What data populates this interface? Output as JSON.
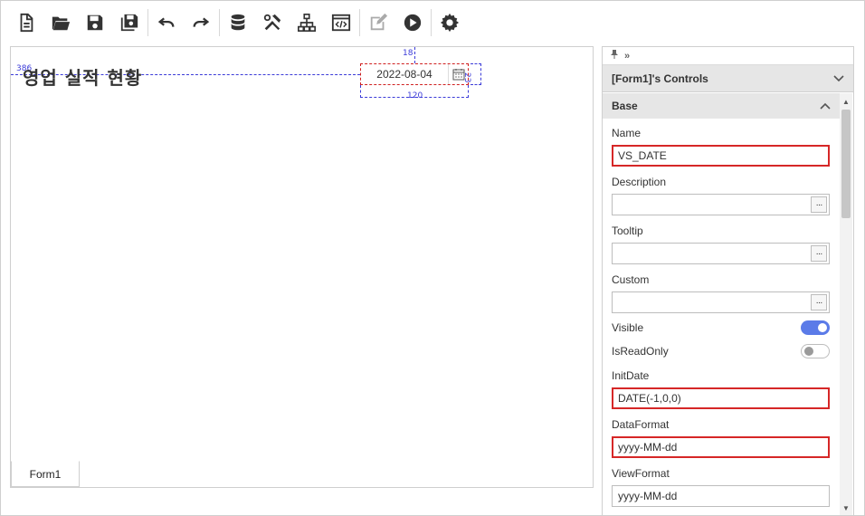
{
  "toolbar": {
    "items": [
      "new-file-icon",
      "open-folder-icon",
      "save-icon",
      "save-all-icon",
      "undo-icon",
      "redo-icon",
      "database-icon",
      "tools-icon",
      "hierarchy-icon",
      "code-icon",
      "edit-icon",
      "run-icon",
      "settings-icon"
    ]
  },
  "canvas": {
    "title_text": "영업 실적 현황",
    "date_value": "2022-08-04",
    "measure_left": "386",
    "measure_top": "18",
    "measure_width": "120",
    "measure_height": "23",
    "tab_label": "Form1"
  },
  "panel": {
    "header": "[Form1]'s Controls",
    "section": "Base",
    "name_label": "Name",
    "name_value": "VS_DATE",
    "description_label": "Description",
    "description_value": "",
    "tooltip_label": "Tooltip",
    "tooltip_value": "",
    "custom_label": "Custom",
    "custom_value": "",
    "visible_label": "Visible",
    "visible_on": true,
    "readonly_label": "IsReadOnly",
    "readonly_on": false,
    "initdate_label": "InitDate",
    "initdate_value": "DATE(-1,0,0)",
    "dataformat_label": "DataFormat",
    "dataformat_value": "yyyy-MM-dd",
    "viewformat_label": "ViewFormat",
    "viewformat_value": "yyyy-MM-dd",
    "dots": "···"
  },
  "colors": {
    "accent": "#5b7be8",
    "highlight": "#d62727",
    "guide": "#3b3bd8"
  }
}
